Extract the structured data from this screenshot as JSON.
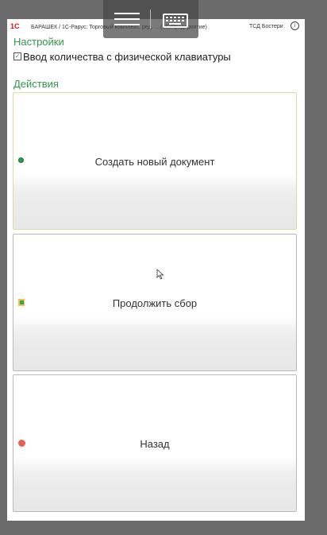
{
  "titlebar": {
    "logo": "1С",
    "title": "БАРАШЕК / 1С-Рарус: Торговый комплекс, ред. ... (1С:Предприятие)",
    "user": "ТСД Бостери"
  },
  "settings": {
    "title": "Настройки",
    "checkbox_label": "Ввод количества с физической клавиатуры",
    "checkbox_checked": true
  },
  "actions": {
    "title": "Действия",
    "items": [
      {
        "label": "Создать новый документ",
        "icon": "plus-circle-icon"
      },
      {
        "label": "Продолжить сбор",
        "icon": "document-icon"
      },
      {
        "label": "Назад",
        "icon": "red-dot-icon"
      }
    ]
  },
  "colors": {
    "accent": "#2f9a4a",
    "background": "#6b6b6b",
    "back_icon": "#e8604e"
  }
}
